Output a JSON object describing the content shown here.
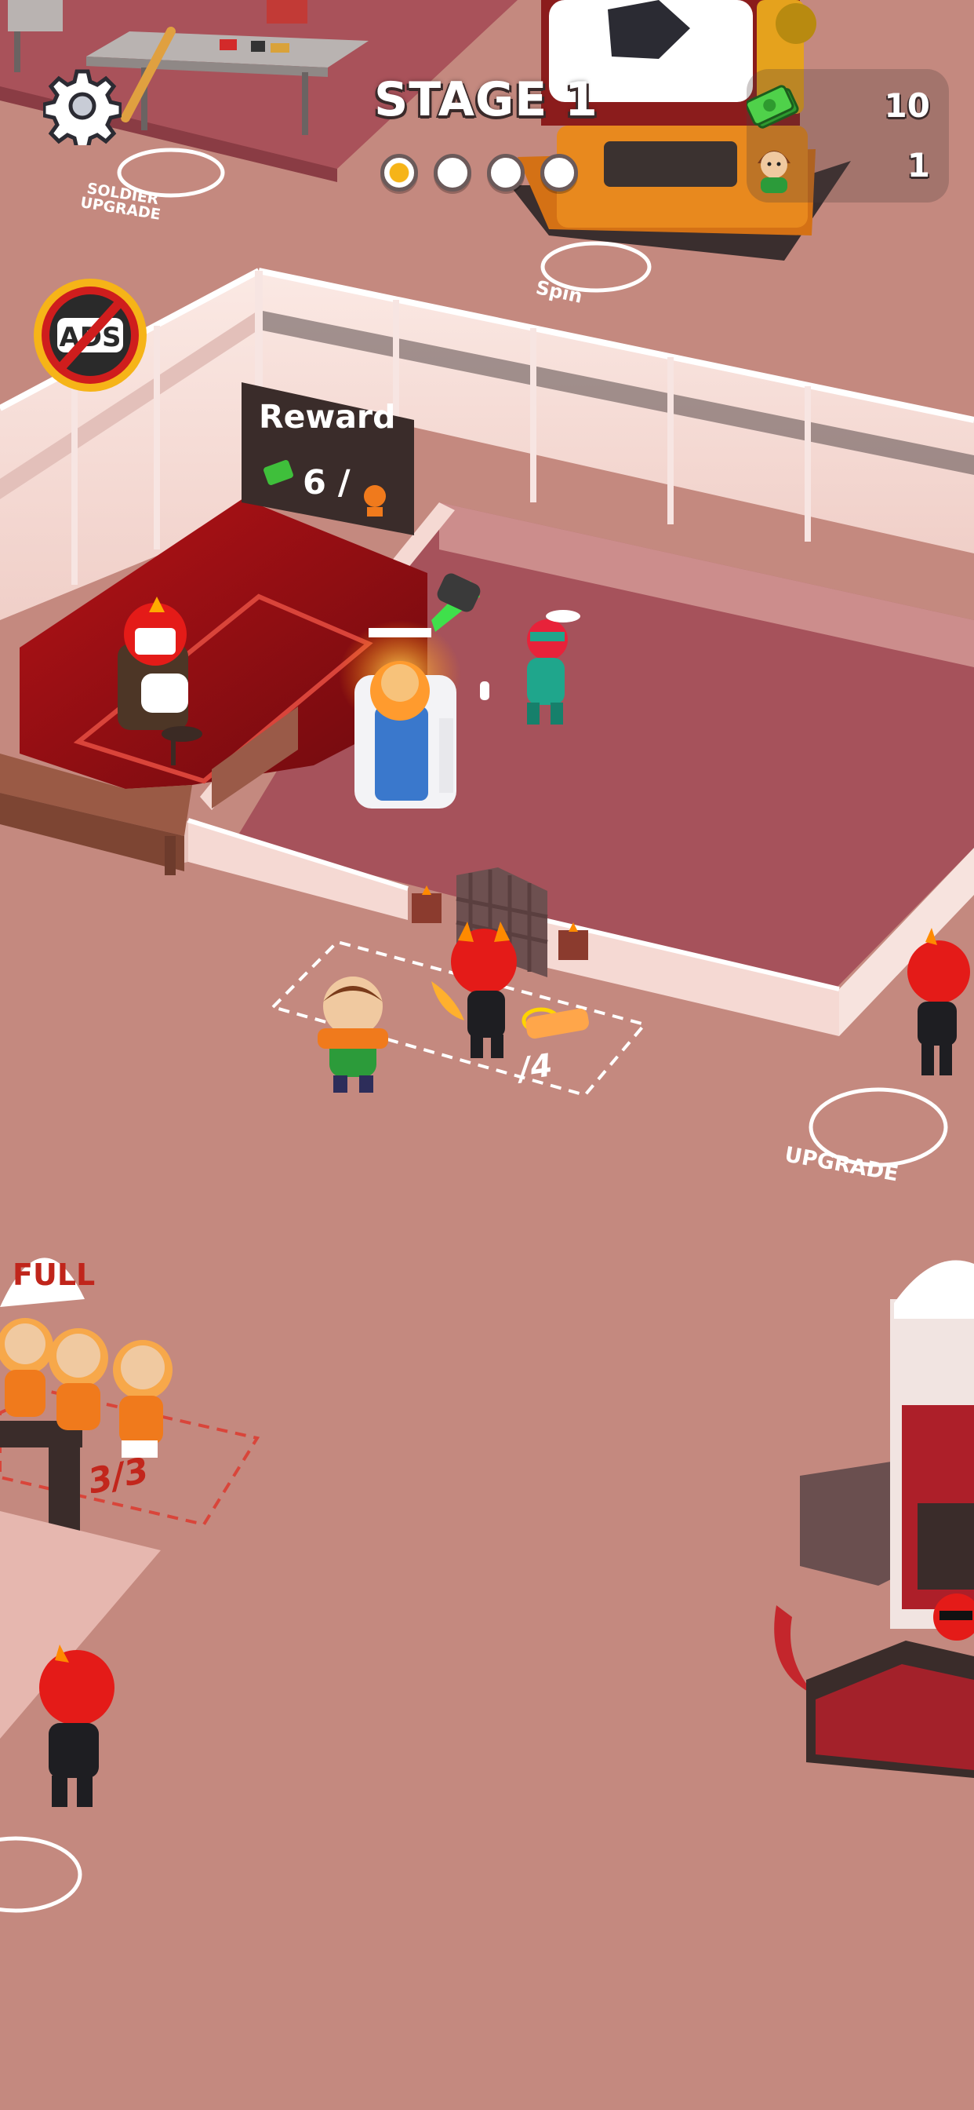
{
  "hud": {
    "stage_title": "STAGE 1",
    "stage_progress": {
      "total": 4,
      "completed": 1
    },
    "resources": {
      "cash": "10",
      "customers": "1"
    },
    "icons": {
      "settings": "gear-icon",
      "no_ads": "no-ads-icon",
      "cash": "cash-icon",
      "customer": "customer-icon"
    }
  },
  "world": {
    "reward_sign": {
      "title": "Reward",
      "count": "6 /"
    },
    "labels": {
      "soldier_upgrade": "SOLDIER UPGRADE",
      "spin": "Spin",
      "upgrade": "UPGRADE",
      "full": "FULL",
      "queue_center": "/4",
      "queue_left": "3/3"
    }
  },
  "colors": {
    "floor": "#c4897f",
    "hell_red": "#8e1014",
    "accent_gold": "#f6b418",
    "cash_green": "#3fbf3b",
    "devil_red": "#e41b18"
  }
}
